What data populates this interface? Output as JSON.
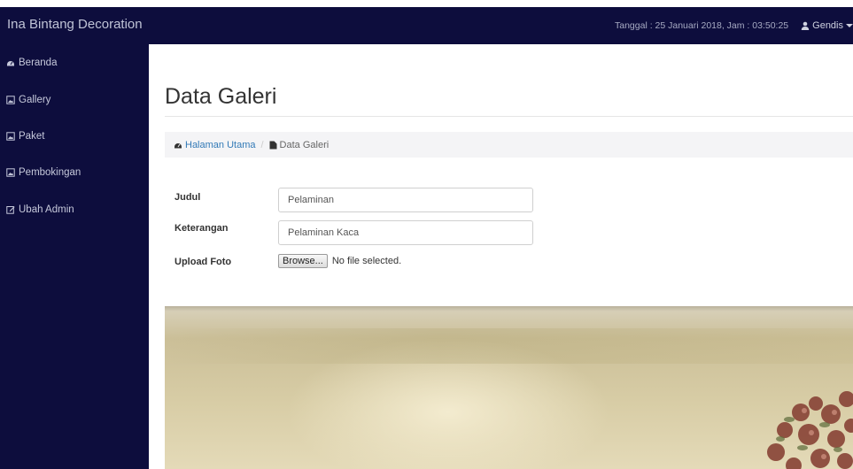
{
  "navbar": {
    "brand": "Ina Bintang Decoration",
    "datetime": "Tanggal : 25 Januari 2018, Jam : 03:50:25",
    "user_name": "Gendis"
  },
  "sidebar": {
    "items": [
      {
        "label": "Beranda",
        "icon": "dashboard-icon"
      },
      {
        "label": "Gallery",
        "icon": "image-icon"
      },
      {
        "label": "Paket",
        "icon": "image-icon"
      },
      {
        "label": "Pembokingan",
        "icon": "image-icon"
      },
      {
        "label": "Ubah Admin",
        "icon": "edit-icon"
      }
    ]
  },
  "main": {
    "title": "Data Galeri",
    "breadcrumb": {
      "home": "Halaman Utama",
      "current": "Data Galeri"
    },
    "form": {
      "judul_label": "Judul",
      "judul_value": "Pelaminan",
      "keterangan_label": "Keterangan",
      "keterangan_value": "Pelaminan Kaca",
      "upload_label": "Upload Foto",
      "browse_label": "Browse...",
      "file_status": "No file selected."
    }
  },
  "colors": {
    "navbar_bg": "#0d0d3d",
    "sidebar_bg": "#0d0d3d",
    "link": "#337ab7"
  }
}
